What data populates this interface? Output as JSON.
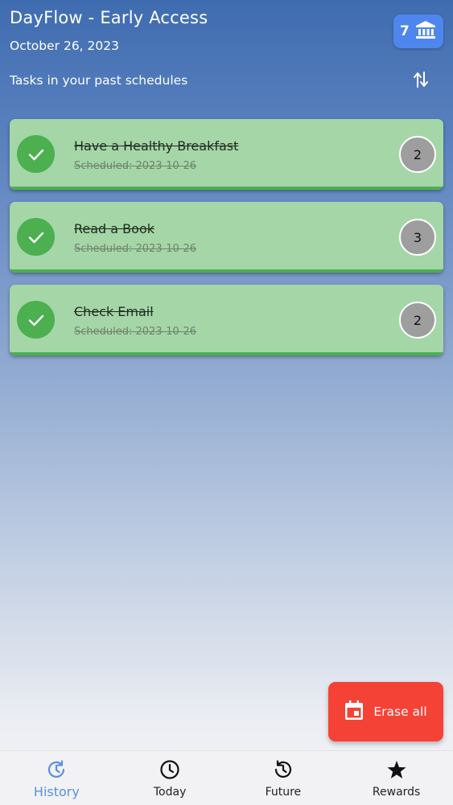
{
  "header": {
    "title": "DayFlow - Early Access",
    "date": "October 26, 2023",
    "points": "7",
    "points_icon": "bank-icon"
  },
  "section": {
    "title": "Tasks in your past schedules",
    "sort_icon": "sort-arrows-icon"
  },
  "tasks": [
    {
      "name": "Have a Healthy Breakfast",
      "scheduled": "Scheduled: 2023-10-26",
      "points": "2",
      "done": true
    },
    {
      "name": "Read a Book",
      "scheduled": "Scheduled: 2023-10-26",
      "points": "3",
      "done": true
    },
    {
      "name": "Check Email",
      "scheduled": "Scheduled: 2023-10-26",
      "points": "2",
      "done": true
    }
  ],
  "fab": {
    "label": "Erase all",
    "icon": "calendar-icon"
  },
  "bottom_nav": [
    {
      "label": "History",
      "icon": "history-icon",
      "active": true
    },
    {
      "label": "Today",
      "icon": "clock-icon",
      "active": false
    },
    {
      "label": "Future",
      "icon": "future-icon",
      "active": false
    },
    {
      "label": "Rewards",
      "icon": "star-icon",
      "active": false
    }
  ],
  "colors": {
    "card": "#a5d6a7",
    "done": "#4caf50",
    "fab": "#f44336",
    "badge": "#4e86ee",
    "nav_active": "#5c8ee0"
  }
}
